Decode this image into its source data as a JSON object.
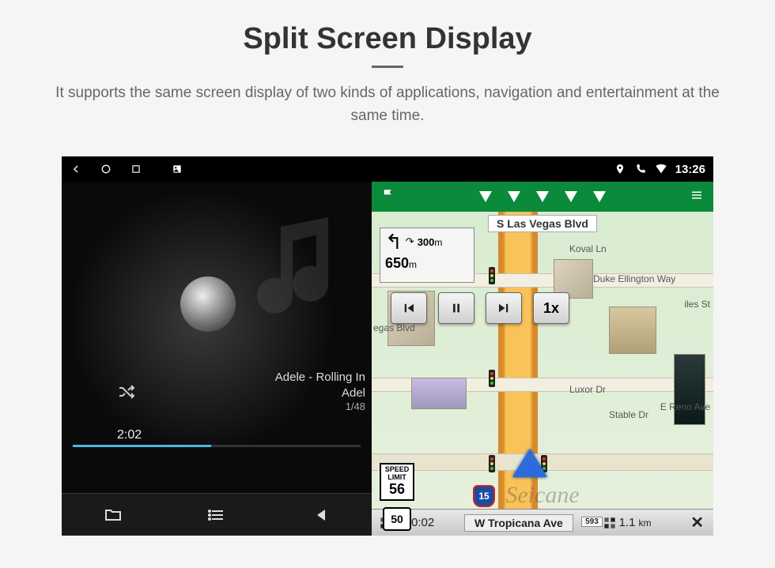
{
  "header": {
    "title": "Split Screen Display",
    "subtitle": "It supports the same screen display of two kinds of applications, navigation and entertainment at the same time."
  },
  "statusbar": {
    "time": "13:26"
  },
  "music": {
    "track_title": "Adele - Rolling In",
    "artist": "Adel",
    "track_index": "1/48",
    "elapsed": "2:02"
  },
  "nav": {
    "top_street": "S Las Vegas Blvd",
    "turn_next_distance_value": "300",
    "turn_next_distance_unit": "m",
    "turn_main_distance_value": "650",
    "turn_main_distance_unit": "m",
    "speed_button": "1x",
    "speed_limit_label": "SPEED LIMIT",
    "speed_limit_value": "56",
    "route_number": "50",
    "interstate_number": "15",
    "bottom_street": "W Tropicana Ave",
    "bottom_street_num": "593",
    "time_to_dest": "0:02",
    "distance_to_dest_value": "1.1",
    "distance_to_dest_unit": "km",
    "labels": {
      "vegas_blvd": "egas Blvd",
      "koval": "Koval Ln",
      "duke": "Duke Ellington Way",
      "luxor": "Luxor Dr",
      "reno": "E Reno Ave",
      "stable": "Stable Dr",
      "iles": "iles St"
    }
  },
  "watermark": "Seicane"
}
